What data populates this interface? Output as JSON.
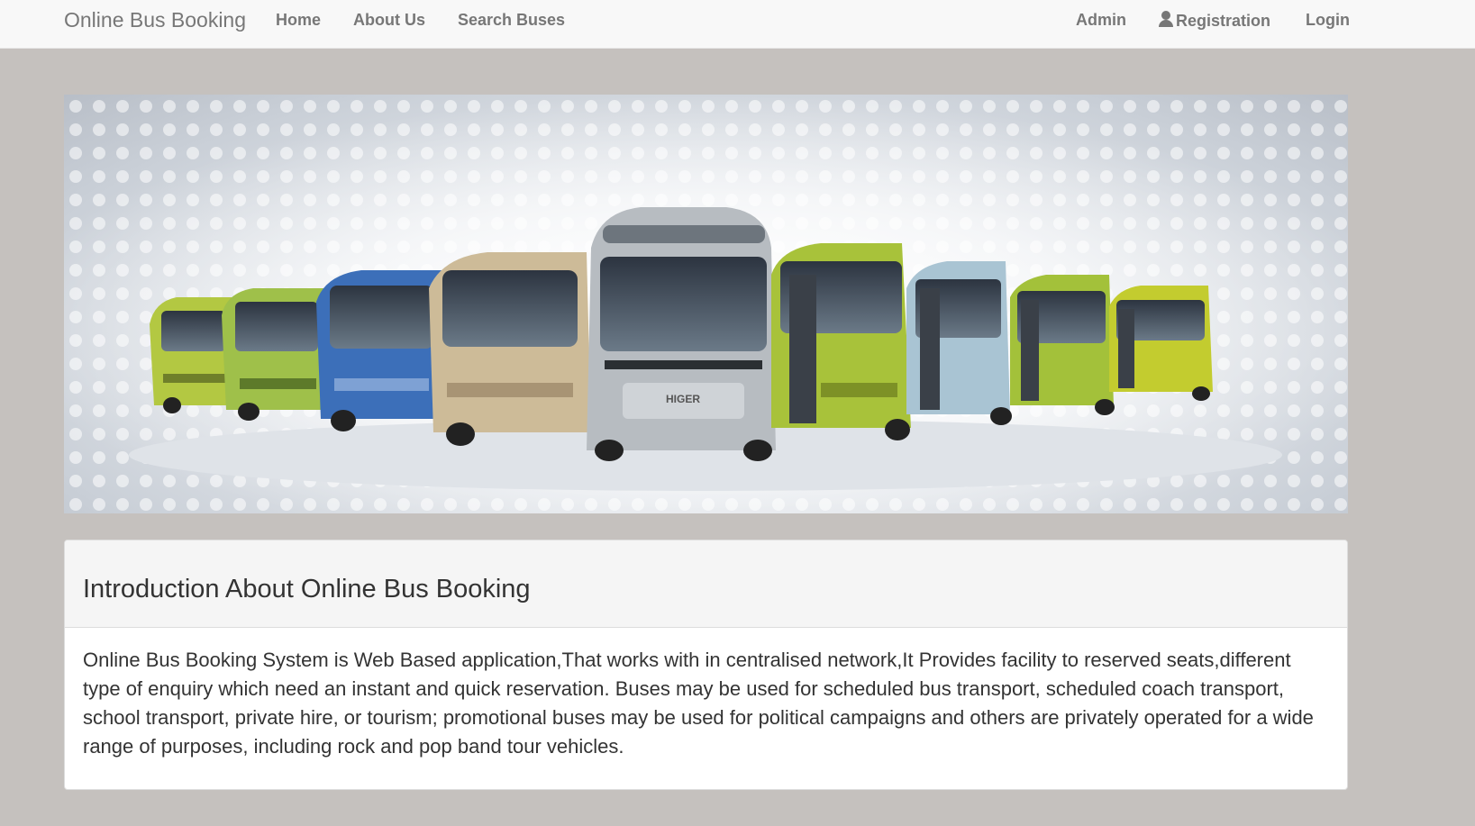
{
  "navbar": {
    "brand": "Online Bus Booking",
    "links": {
      "home": "Home",
      "about": "About Us",
      "search": "Search Buses",
      "admin": "Admin",
      "registration": "Registration",
      "login": "Login"
    }
  },
  "banner": {
    "bus_logo_text": "HIGER"
  },
  "panel": {
    "title": "Introduction About Online Bus Booking",
    "body": "Online Bus Booking System is Web Based application,That works with in centralised network,It Provides facility to reserved seats,different type of enquiry which need an instant and quick reservation. Buses may be used for scheduled bus transport, scheduled coach transport, school transport, private hire, or tourism; promotional buses may be used for political campaigns and others are privately operated for a wide range of purposes, including rock and pop band tour vehicles."
  },
  "colors": {
    "page_bg": "#c5c1be",
    "navbar_bg": "#f8f8f8",
    "nav_text": "#777777",
    "bus_green": "#a8c03a",
    "bus_blue": "#3b6fb8",
    "bus_beige": "#c9b89a",
    "bus_silver": "#b9bdc1"
  }
}
